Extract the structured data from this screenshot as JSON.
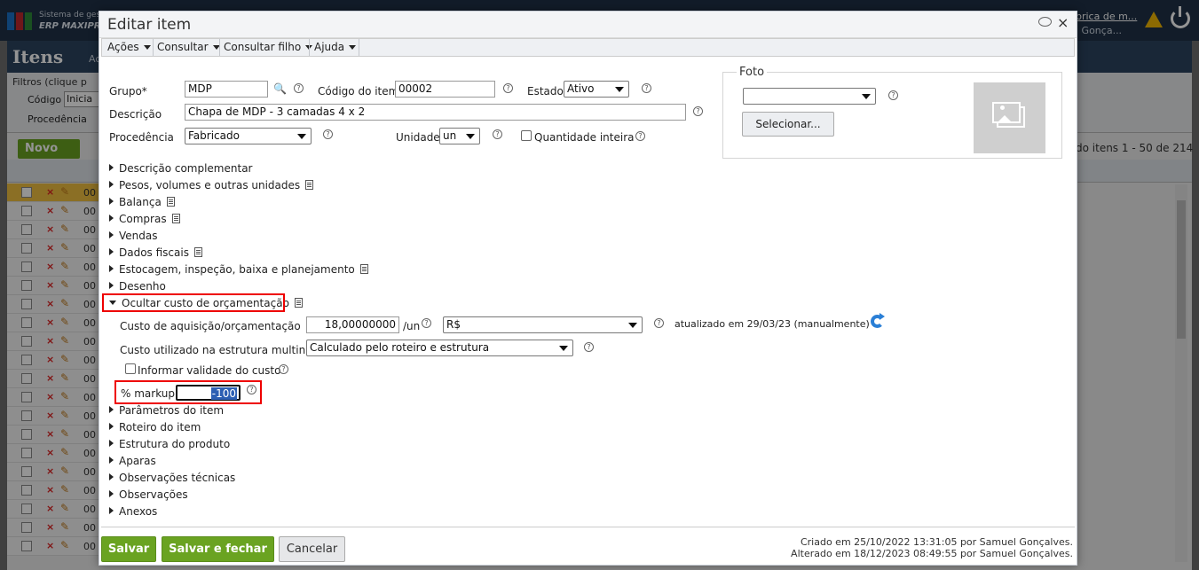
{
  "background": {
    "sys_name": "Sistema de gest",
    "erp_name": "ERP MAXIPRO",
    "user_link": "brica de m...",
    "user_name": "l Gonça...",
    "module_title": "Itens",
    "module_tab": "Ac",
    "filter_title": "Filtros (clique p",
    "filter_codigo_label": "Código",
    "filter_codigo_value": "Inicia",
    "filter_procedencia_label": "Procedência",
    "new_button": "Novo",
    "pagination": "do itens 1 - 50 de 214",
    "row_code": "00"
  },
  "dialog": {
    "title": "Editar item",
    "menus": [
      "Ações",
      "Consultar",
      "Consultar filho",
      "Ajuda"
    ],
    "fields": {
      "grupo_label": "Grupo*",
      "grupo_value": "MDP",
      "codigo_label": "Código do item",
      "codigo_value": "00002",
      "estado_label": "Estado",
      "estado_value": "Ativo",
      "descricao_label": "Descrição",
      "descricao_value": "Chapa de MDP - 3 camadas 4 x 2",
      "procedencia_label": "Procedência",
      "procedencia_value": "Fabricado",
      "unidade_label": "Unidade",
      "unidade_value": "un",
      "qtd_inteira_label": "Quantidade inteira"
    },
    "foto": {
      "label": "Foto",
      "select_value": "",
      "button": "Selecionar..."
    },
    "sections": [
      "Descrição complementar",
      "Pesos, volumes e outras unidades",
      "Balança",
      "Compras",
      "Vendas",
      "Dados fiscais",
      "Estocagem, inspeção, baixa e planejamento",
      "Desenho",
      "Ocultar custo de orçamentação"
    ],
    "cost": {
      "custo_label": "Custo de aquisição/orçamentação",
      "custo_value": "18,00000000",
      "custo_unit": "/un",
      "currency": "R$",
      "updated": "atualizado em 29/03/23 (manualmente)",
      "estrutura_label": "Custo utilizado na estrutura multinível",
      "estrutura_value": "Calculado pelo roteiro e estrutura",
      "validade_label": "Informar validade do custo",
      "markup_label": "% markup",
      "markup_value": "-100"
    },
    "sections_after": [
      "Parâmetros do item",
      "Roteiro do item",
      "Estrutura do produto",
      "Aparas",
      "Observações técnicas",
      "Observações",
      "Anexos"
    ],
    "buttons": {
      "save": "Salvar",
      "save_close": "Salvar e fechar",
      "cancel": "Cancelar"
    },
    "audit": {
      "created": "Criado em 25/10/2022 13:31:05 por Samuel Gonçalves.",
      "changed": "Alterado em 18/12/2023 08:49:55 por Samuel Gonçalves."
    }
  }
}
